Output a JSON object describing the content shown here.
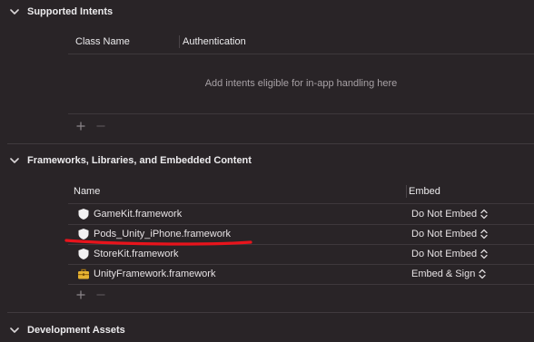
{
  "sections": {
    "intents": {
      "title": "Supported Intents",
      "columns": [
        "Class Name",
        "Authentication"
      ],
      "empty_message": "Add intents eligible for in-app handling here"
    },
    "frameworks": {
      "title": "Frameworks, Libraries, and Embedded Content",
      "columns": [
        "Name",
        "Embed"
      ],
      "rows": [
        {
          "name": "GameKit.framework",
          "embed": "Do Not Embed",
          "icon": "shield-icon"
        },
        {
          "name": "Pods_Unity_iPhone.framework",
          "embed": "Do Not Embed",
          "icon": "shield-icon"
        },
        {
          "name": "StoreKit.framework",
          "embed": "Do Not Embed",
          "icon": "shield-icon"
        },
        {
          "name": "UnityFramework.framework",
          "embed": "Embed & Sign",
          "icon": "toolbox-icon"
        }
      ]
    },
    "assets": {
      "title": "Development Assets"
    }
  },
  "colors": {
    "background": "#292427",
    "annotation_underline": "#e8141c",
    "toolbox_icon": "#e5b232"
  }
}
